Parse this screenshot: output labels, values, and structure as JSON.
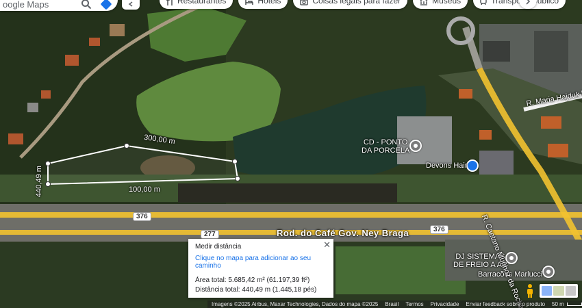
{
  "search": {
    "placeholder_text": "oogle Maps"
  },
  "chips": [
    {
      "label": "Restaurantes",
      "icon": "fork-knife-icon"
    },
    {
      "label": "Hotéis",
      "icon": "bed-icon"
    },
    {
      "label": "Coisas legais para fazer",
      "icon": "camera-icon"
    },
    {
      "label": "Museus",
      "icon": "museum-icon"
    },
    {
      "label": "Transporte público",
      "icon": "train-icon"
    }
  ],
  "measurement": {
    "segment_labels": [
      "300,00 m",
      "100,00 m",
      "440,49 m"
    ]
  },
  "places": {
    "cd": "CD - PONTO\nDA PORCELA",
    "devons": "Devons Hair",
    "dj": "DJ SISTEMAS\nDE FREIO A AR",
    "barracoes": "Barracões Marlucci"
  },
  "roads": {
    "main": "Rod. do Café Gov. Ney Braga",
    "street_right": "R. Maria Hajduk la",
    "street_vertical": "R. Caetano Munhoz da Rocha",
    "shields": [
      "376",
      "277",
      "376"
    ]
  },
  "measure_panel": {
    "title": "Medir distância",
    "hint": "Clique no mapa para adicionar ao seu caminho",
    "area": "Área total: 5.685,42 m² (61.197,39 ft²)",
    "distance": "Distância total: 440,49 m (1.445,18 pés)",
    "close": "✕"
  },
  "attribution": {
    "imagery": "Imagens ©2025 Airbus, Maxar Technologies, Dados do mapa ©2025",
    "country": "Brasil",
    "terms": "Termos",
    "privacy": "Privacidade",
    "feedback": "Enviar feedback sobre o produto",
    "scale": "50 m"
  },
  "colors": {
    "accent": "#1a73e8",
    "measure_line": "#ffffff"
  }
}
